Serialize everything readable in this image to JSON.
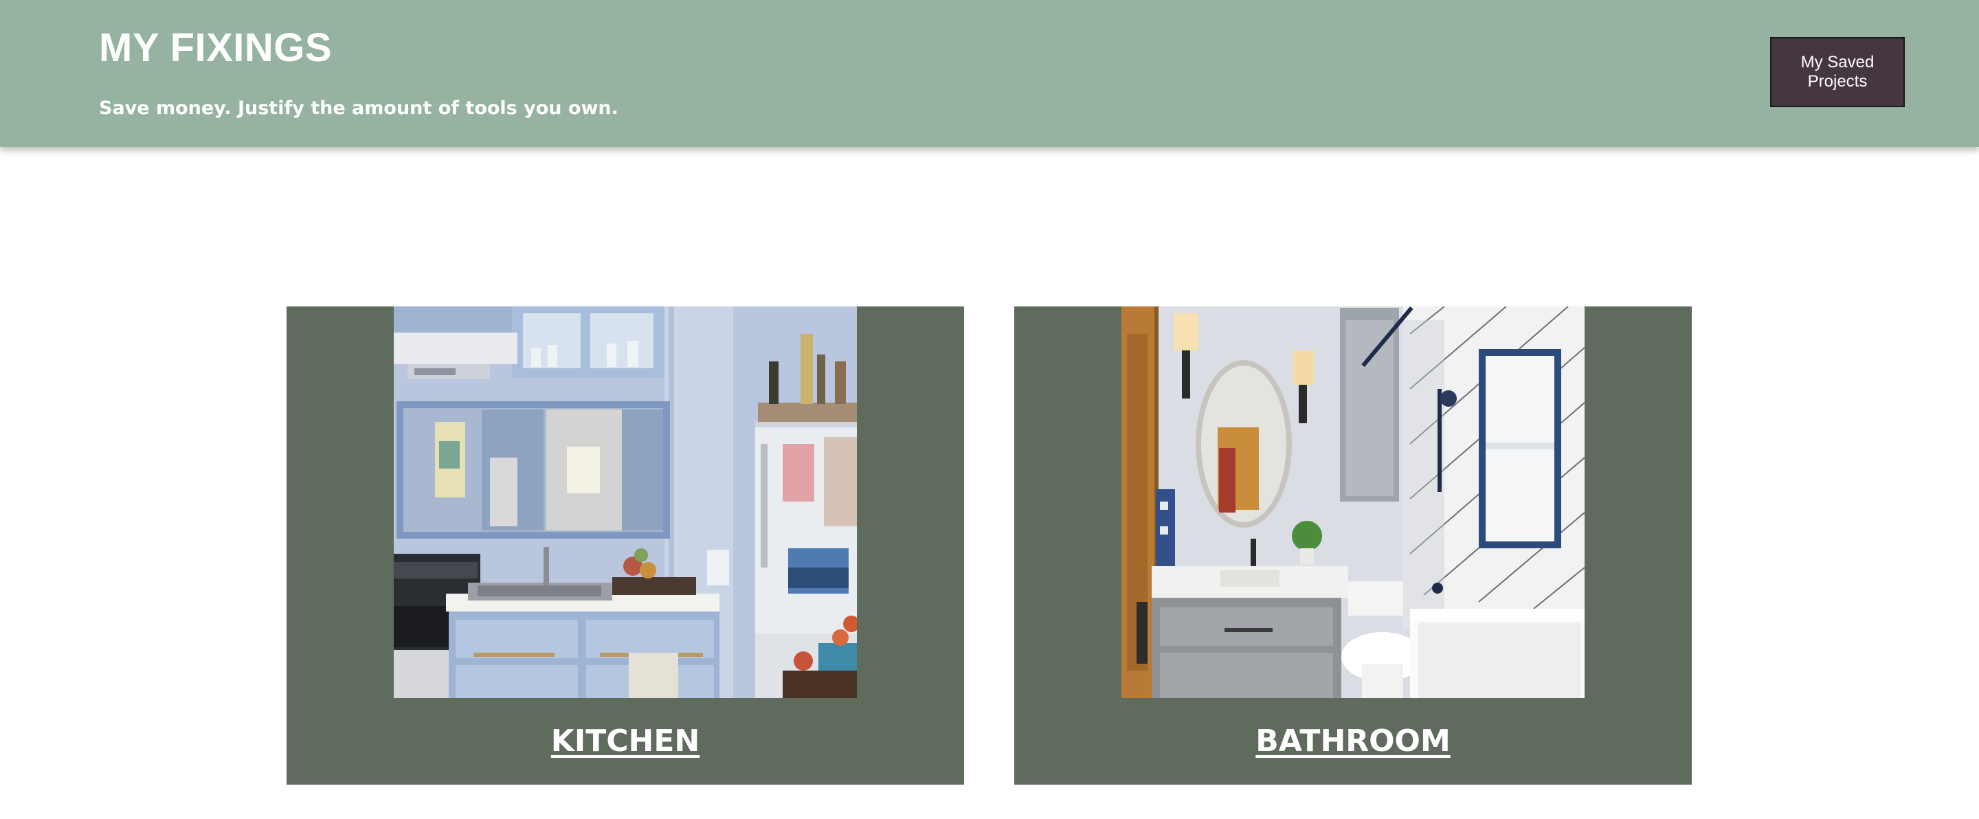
{
  "header": {
    "title": "MY FIXINGS",
    "tagline": "Save money. Justify the amount of tools you own.",
    "saved_button_label": "My Saved Projects"
  },
  "rooms": [
    {
      "label": "KITCHEN",
      "image": "kitchen-photo"
    },
    {
      "label": "BATHROOM",
      "image": "bathroom-photo"
    }
  ],
  "colors": {
    "header_bg": "#95b3a0",
    "card_bg": "#5f6b5d",
    "button_bg": "#45373f",
    "text": "#ffffff"
  }
}
